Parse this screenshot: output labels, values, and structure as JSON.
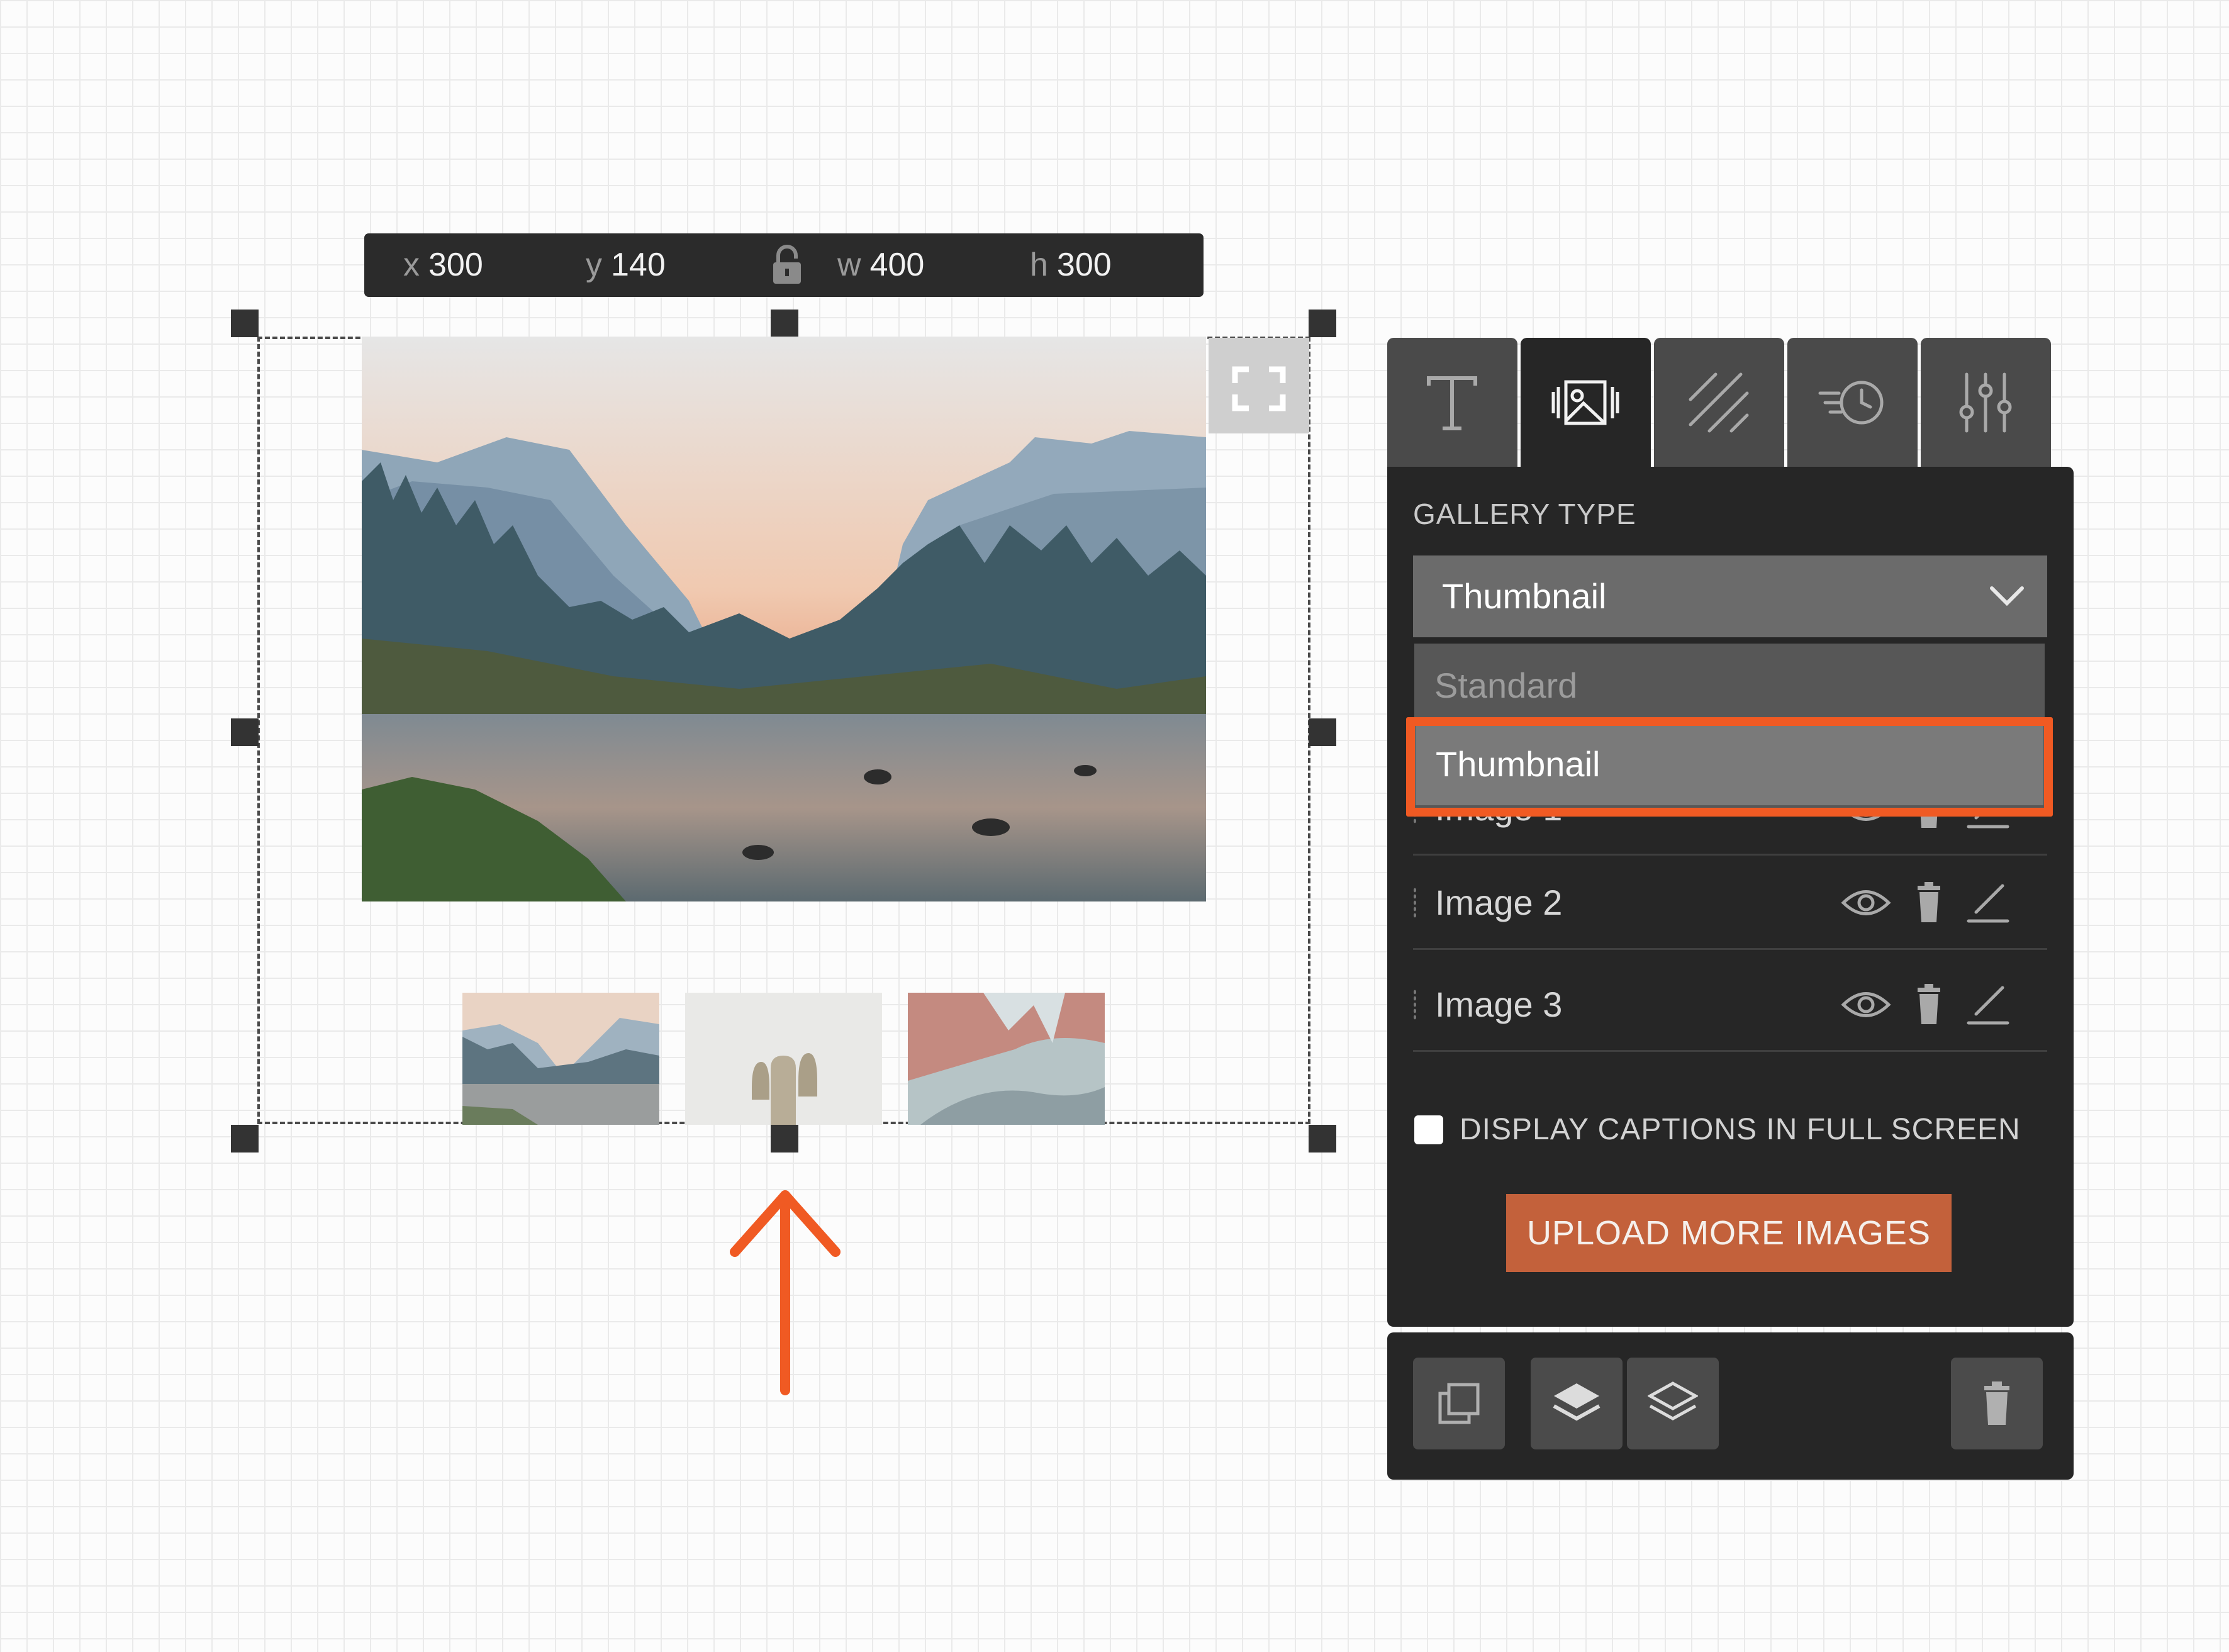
{
  "coords": {
    "x_key": "x",
    "x_val": "300",
    "y_key": "y",
    "y_val": "140",
    "w_key": "w",
    "w_val": "400",
    "h_key": "h",
    "h_val": "300"
  },
  "tabs": [
    {
      "icon": "text-icon",
      "active": false
    },
    {
      "icon": "gallery-icon",
      "active": true
    },
    {
      "icon": "texture-icon",
      "active": false
    },
    {
      "icon": "animation-icon",
      "active": false
    },
    {
      "icon": "settings-sliders-icon",
      "active": false
    }
  ],
  "gallery": {
    "type_label": "GALLERY TYPE",
    "selected": "Thumbnail",
    "options": [
      "Standard",
      "Thumbnail"
    ],
    "highlighted_option": "Thumbnail"
  },
  "images": [
    {
      "name": "Image 1"
    },
    {
      "name": "Image 2"
    },
    {
      "name": "Image 3"
    }
  ],
  "captions_label": "DISPLAY CAPTIONS IN FULL SCREEN",
  "captions_checked": false,
  "upload_label": "UPLOAD MORE IMAGES",
  "colors": {
    "accent": "#f05a23",
    "upload_button": "#c3613b",
    "panel_bg": "#262626"
  }
}
